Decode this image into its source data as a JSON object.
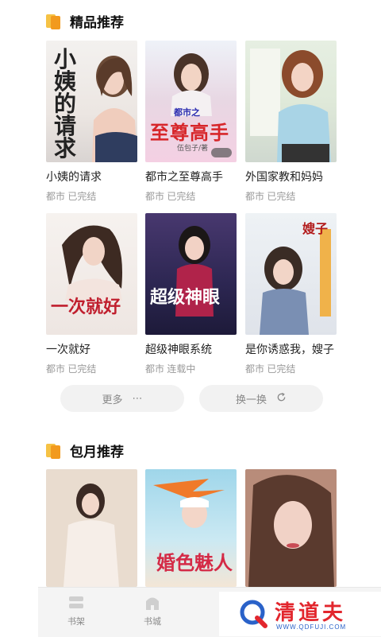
{
  "sections": {
    "premium": {
      "title": "精品推荐"
    },
    "monthly": {
      "title": "包月推荐"
    }
  },
  "premium_books": [
    {
      "title": "小姨的请求",
      "meta": "都市 已完结",
      "cover_text": [
        "小",
        "姨",
        "的",
        "请",
        "求"
      ]
    },
    {
      "title": "都市之至尊高手",
      "meta": "都市 已完结",
      "cover_text": "至尊高手",
      "cover_sub": "都市之",
      "cover_author": "伍包子/著"
    },
    {
      "title": "外国家教和妈妈",
      "meta": "都市 已完结"
    },
    {
      "title": "一次就好",
      "meta": "都市 已完结",
      "cover_text": "一次就好"
    },
    {
      "title": "超级神眼系统",
      "meta": "都市 连载中",
      "cover_text": "超级神眼"
    },
    {
      "title": "是你诱惑我，嫂子",
      "meta": "都市 已完结",
      "cover_text": "嫂子"
    }
  ],
  "monthly_books": [
    {
      "title": ""
    },
    {
      "title": "",
      "cover_text": "婚色魅人"
    },
    {
      "title": ""
    }
  ],
  "actions": {
    "more_label": "更多",
    "more_icon": "ellipsis-icon",
    "refresh_label": "换一换",
    "refresh_icon": "refresh-icon"
  },
  "tabbar": {
    "items": [
      {
        "label": "书架",
        "icon": "bookshelf-icon"
      },
      {
        "label": "书城",
        "icon": "bookstore-icon"
      }
    ]
  },
  "watermark": {
    "text": "清道夫",
    "sub": "WWW.QDFUJI.COM"
  },
  "colors": {
    "accent": "#f29a1e",
    "accent_light": "#f6c244",
    "meta_gray": "#9a9a9a",
    "pill_bg": "#f2f2f2",
    "watermark_red": "#e2262d"
  }
}
